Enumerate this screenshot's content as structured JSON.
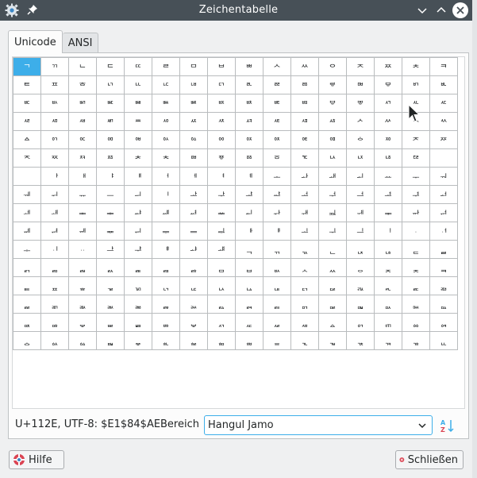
{
  "window": {
    "title": "Zeichentabelle",
    "app_icon": "gear-icon",
    "pin_icon": "pin-icon",
    "controls": [
      "minimize-icon",
      "maximize-icon",
      "close-icon"
    ]
  },
  "tabs": [
    {
      "label": "Unicode",
      "active": true
    },
    {
      "label": "ANSI",
      "active": false
    }
  ],
  "grid": {
    "selected_index": 0,
    "cells": [
      "ᄀ",
      "ᄁ",
      "ᄂ",
      "ᄃ",
      "ᄄ",
      "ᄅ",
      "ᄆ",
      "ᄇ",
      "ᄈ",
      "ᄉ",
      "ᄊ",
      "ᄋ",
      "ᄌ",
      "ᄍ",
      "ᄎ",
      "ᄏ",
      "ᄐ",
      "ᄑ",
      "ᄒ",
      "ᄓ",
      "ᄔ",
      "ᄕ",
      "ᄖ",
      "ᄗ",
      "ᄘ",
      "ᄙ",
      "ᄚ",
      "ᄛ",
      "ᄜ",
      "ᄝ",
      "ᄞ",
      "ᄟ",
      "ᄠ",
      "ᄡ",
      "ᄢ",
      "ᄣ",
      "ᄤ",
      "ᄥ",
      "ᄦ",
      "ᄧ",
      "ᄨ",
      "ᄩ",
      "ᄪ",
      "ᄫ",
      "ᄬ",
      "ᄭ",
      "ᄮ",
      "ᄯ",
      "ᄰ",
      "ᄱ",
      "ᄲ",
      "ᄳ",
      "ᄴ",
      "ᄵ",
      "ᄶ",
      "ᄷ",
      "ᄸ",
      "ᄹ",
      "ᄺ",
      "ᄻ",
      "ᄼ",
      "ᄽ",
      "ᄾ",
      "ᄿ",
      "ᅀ",
      "ᅁ",
      "ᅂ",
      "ᅃ",
      "ᅄ",
      "ᅅ",
      "ᅆ",
      "ᅇ",
      "ᅈ",
      "ᅉ",
      "ᅊ",
      "ᅋ",
      "ᅌ",
      "ᅍ",
      "ᅎ",
      "ᅏ",
      "ᅐ",
      "ᅑ",
      "ᅒ",
      "ᅓ",
      "ᅔ",
      "ᅕ",
      "ᅖ",
      "ᅗ",
      "ᅘ",
      "ᅙ",
      "ᅚ",
      "ᅛ",
      "ᅜ",
      "ᅝ",
      "ᅞ",
      "ᅟ",
      "ᅠ",
      "ᅡ",
      "ᅢ",
      "ᅣ",
      "ᅤ",
      "ᅥ",
      "ᅦ",
      "ᅧ",
      "ᅨ",
      "ᅩ",
      "ᅪ",
      "ᅫ",
      "ᅬ",
      "ᅭ",
      "ᅮ",
      "ᅯ",
      "ᅰ",
      "ᅱ",
      "ᅲ",
      "ᅳ",
      "ᅴ",
      "ᅵ",
      "ᅶ",
      "ᅷ",
      "ᅸ",
      "ᅹ",
      "ᅺ",
      "ᅻ",
      "ᅼ",
      "ᅽ",
      "ᅾ",
      "ᅿ",
      "ᆀ",
      "ᆁ",
      "ᆂ",
      "ᆃ",
      "ᆄ",
      "ᆅ",
      "ᆆ",
      "ᆇ",
      "ᆈ",
      "ᆉ",
      "ᆊ",
      "ᆋ",
      "ᆌ",
      "ᆍ",
      "ᆎ",
      "ᆏ",
      "ᆐ",
      "ᆑ",
      "ᆒ",
      "ᆓ",
      "ᆔ",
      "ᆕ",
      "ᆖ",
      "ᆗ",
      "ᆘ",
      "ᆙ",
      "ᆚ",
      "ᆛ",
      "ᆜ",
      "ᆝ",
      "ᆞ",
      "ᆟ",
      "ᆠ",
      "ᆡ",
      "ᆢ",
      "ᆣ",
      "ᆤ",
      "ᆥ",
      "ᆦ",
      "ᆧ",
      "ᆨ",
      "ᆩ",
      "ᆪ",
      "ᆫ",
      "ᆬ",
      "ᆭ",
      "ᆮ",
      "ᆯ",
      "ᆰ",
      "ᆱ",
      "ᆲ",
      "ᆳ",
      "ᆴ",
      "ᆵ",
      "ᆶ",
      "ᆷ",
      "ᆸ",
      "ᆹ",
      "ᆺ",
      "ᆻ",
      "ᆼ",
      "ᆽ",
      "ᆾ",
      "ᆿ",
      "ᇀ",
      "ᇁ",
      "ᇂ",
      "ᇃ",
      "ᇄ",
      "ᇅ",
      "ᇆ",
      "ᇇ",
      "ᇈ",
      "ᇉ",
      "ᇊ",
      "ᇋ",
      "ᇌ",
      "ᇍ",
      "ᇎ",
      "ᇏ",
      "ᇐ",
      "ᇑ",
      "ᇒ",
      "ᇓ",
      "ᇔ",
      "ᇕ",
      "ᇖ",
      "ᇗ",
      "ᇘ",
      "ᇙ",
      "ᇚ",
      "ᇛ",
      "ᇜ",
      "ᇝ",
      "ᇞ",
      "ᇟ",
      "ᇠ",
      "ᇡ",
      "ᇢ",
      "ᇣ",
      "ᇤ",
      "ᇥ",
      "ᇦ",
      "ᇧ",
      "ᇨ",
      "ᇩ",
      "ᇪ",
      "ᇫ",
      "ᇬ",
      "ᇭ",
      "ᇮ",
      "ᇯ",
      "ᇰ",
      "ᇱ",
      "ᇲ",
      "ᇳ",
      "ᇴ",
      "ᇵ",
      "ᇶ",
      "ᇷ",
      "ᇸ",
      "ᇹ",
      "ᇺ",
      "ᇻ",
      "ᇼ",
      "ᇽ",
      "ᇾ",
      "ᇿ"
    ]
  },
  "info": {
    "code_text": "U+112E, UTF-8: $E1$84$AE",
    "range_label": "Bereich",
    "range_value": "Hangul Jamo"
  },
  "buttons": {
    "help_label": "Hilfe",
    "close_label": "Schließen"
  },
  "colors": {
    "titlebar": "#475057",
    "selection": "#3daee9",
    "close_red": "#da4453"
  }
}
